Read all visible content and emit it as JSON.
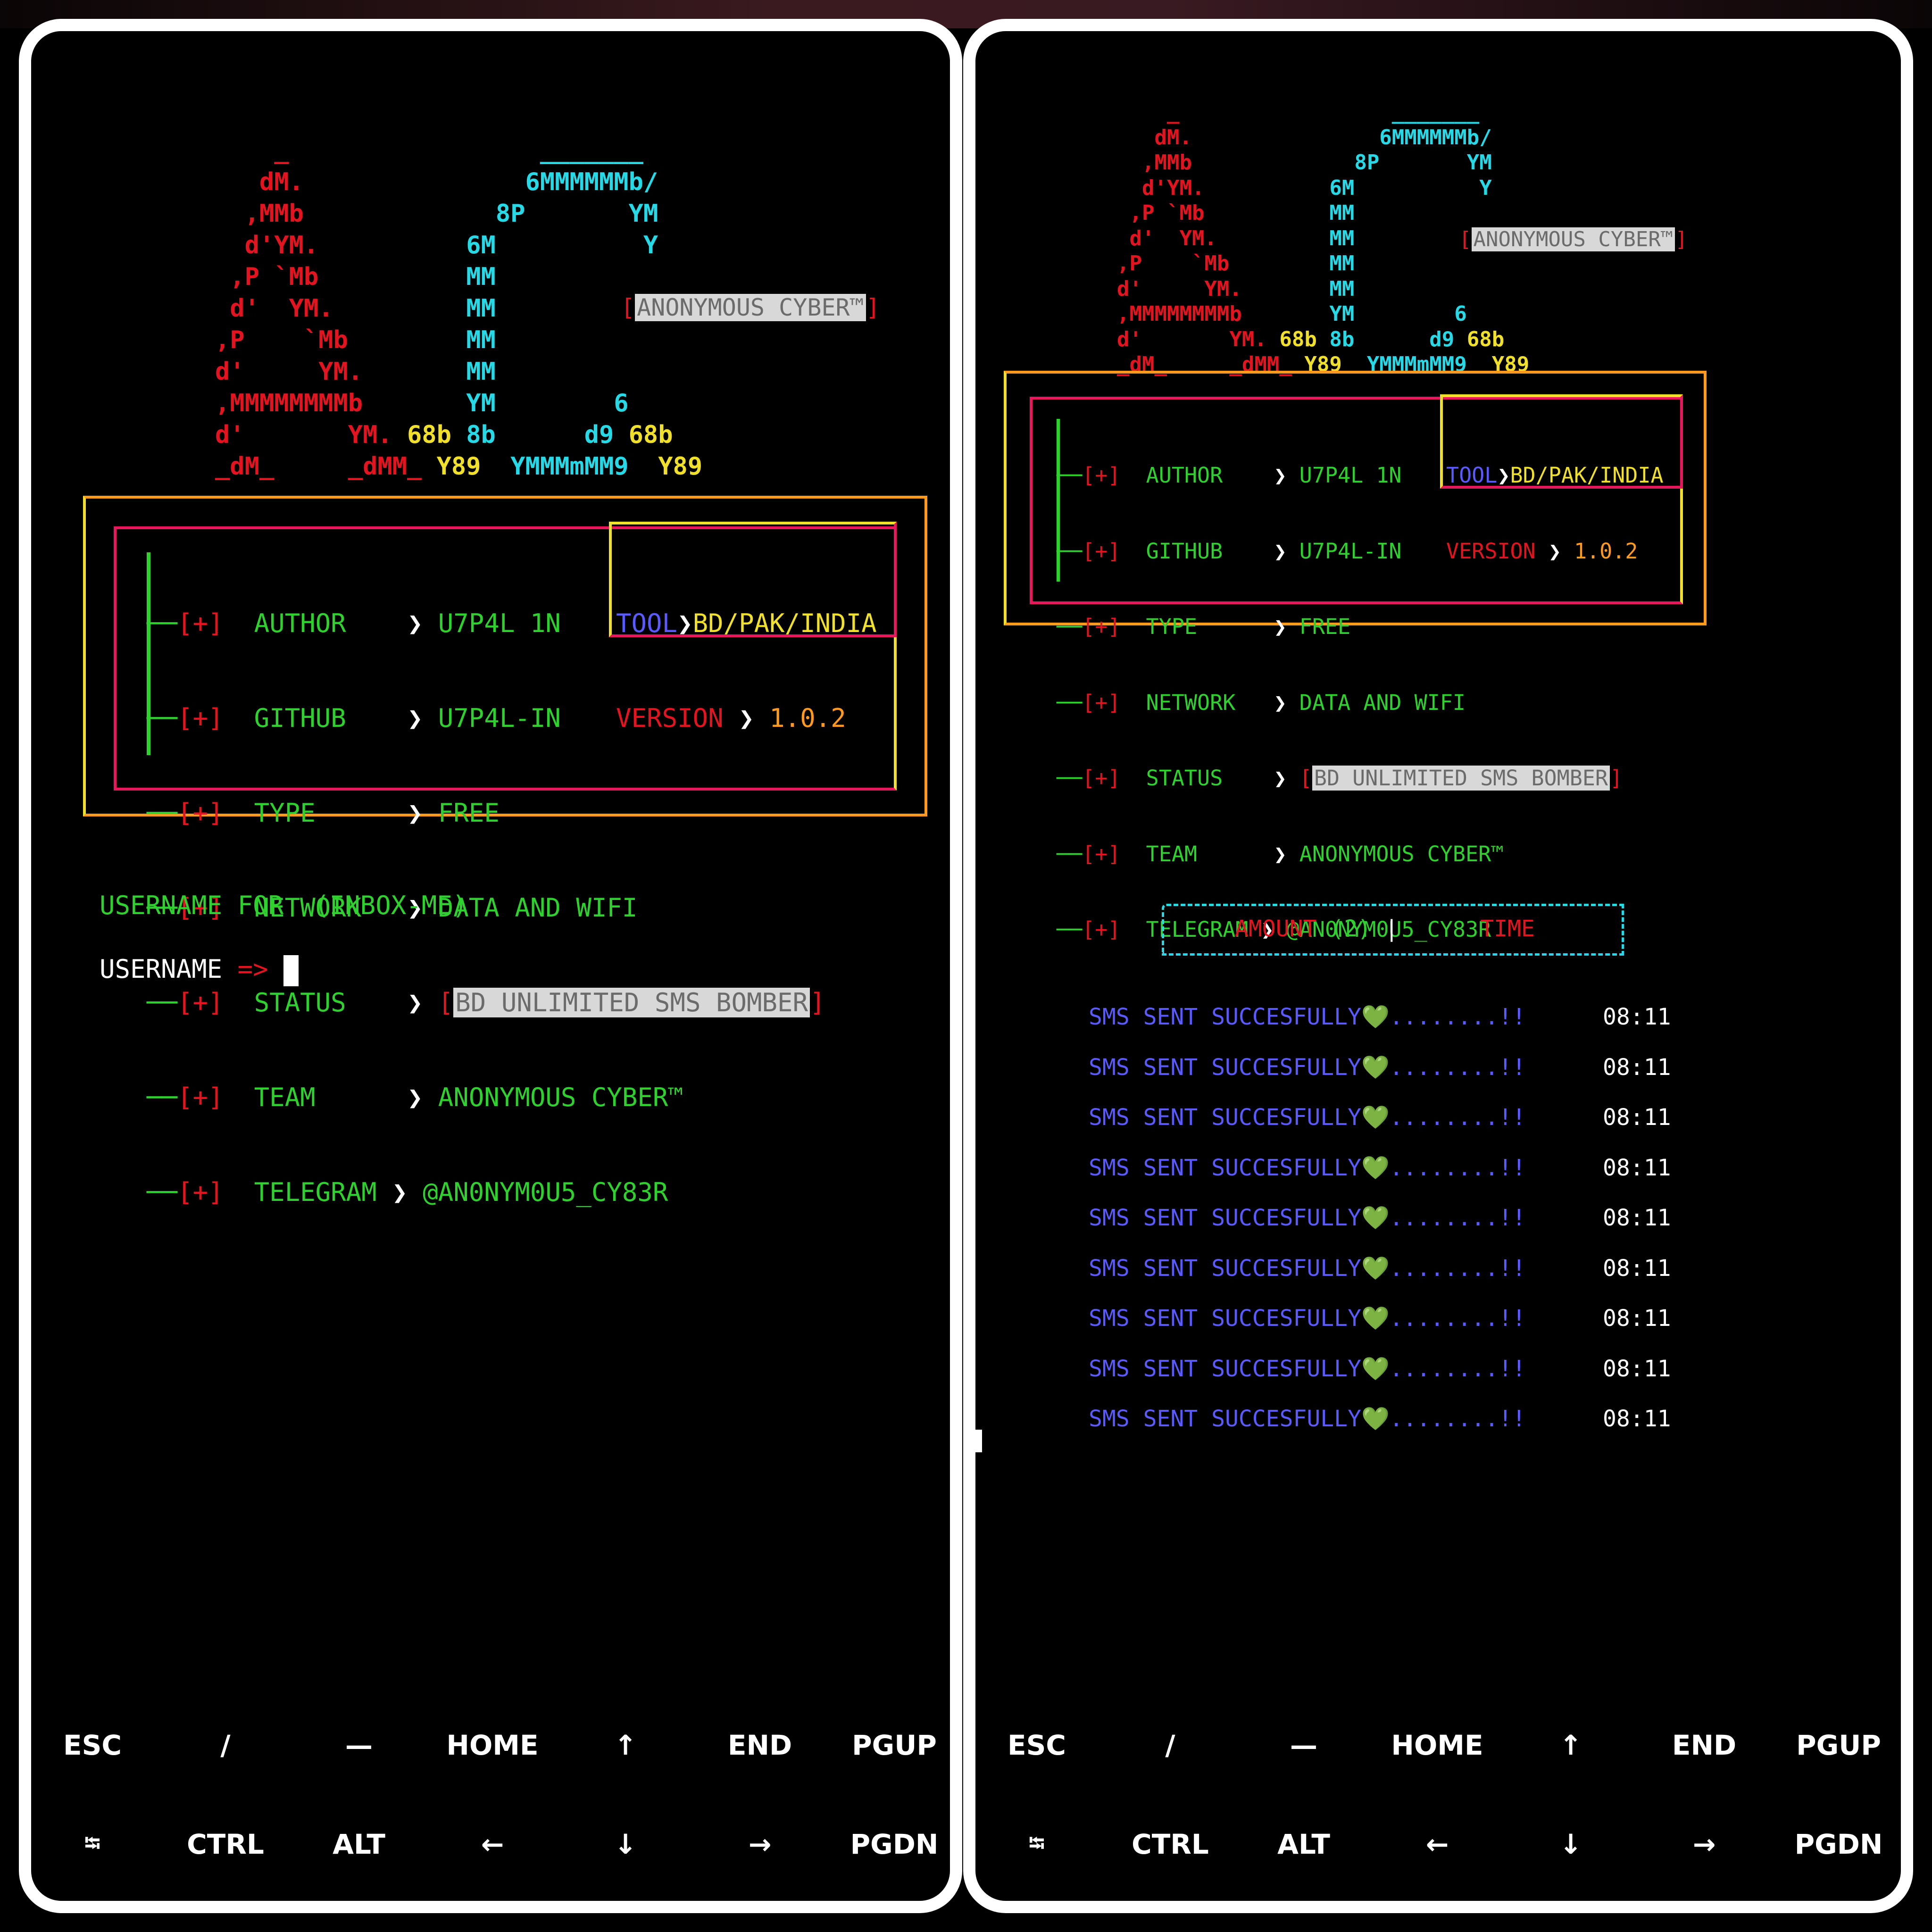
{
  "panels": {
    "left": {
      "id": "left"
    },
    "right": {
      "id": "right"
    }
  },
  "banner": {
    "badge": "ANONYMOUS CYBER™",
    "badge_bracket_open": "[",
    "badge_bracket_close": "]"
  },
  "info": {
    "bullet": "[+]",
    "rows": [
      {
        "key": "AUTHOR",
        "value": "U7P4L 1N"
      },
      {
        "key": "GITHUB",
        "value": "U7P4L-IN"
      },
      {
        "key": "TYPE",
        "value": "FREE"
      },
      {
        "key": "NETWORK",
        "value": "DATA AND WIFI"
      },
      {
        "key": "STATUS",
        "value": "BD UNLIMITED SMS BOMBER"
      },
      {
        "key": "TEAM",
        "value": "ANONYMOUS CYBER™"
      },
      {
        "key": "TELEGRAM",
        "value": "@AN0NYM0U5_CY83R"
      }
    ],
    "arrow": "❯",
    "tool_label": "TOOL",
    "tool_value": "BD/PAK/INDIA",
    "version_label": "VERSION",
    "version_value": "1.0.2"
  },
  "prompt": {
    "heading": "USERNAME FOR  (INBOX-ME)",
    "label": "USERNAME",
    "arrow": "=>"
  },
  "results": {
    "amount_label": "AMOUNT",
    "amount_value": "(2)",
    "time_label": "TIME",
    "message": "SMS SENT SUCCESFULLY",
    "heart": "💚",
    "dots": "........!!",
    "time_value": "08:11",
    "count": 9
  },
  "keyboard": {
    "row1": [
      "ESC",
      "/",
      "—",
      "HOME",
      "↑",
      "END",
      "PGUP"
    ],
    "row2": [
      "⭾",
      "CTRL",
      "ALT",
      "←",
      "↓",
      "→",
      "PGDN"
    ]
  },
  "colors": {
    "red": "#e3141f",
    "cyan": "#26d9e6",
    "yellow": "#f0e02a",
    "green": "#2fd12f",
    "orange": "#ff9a1f",
    "blue": "#5a5aff",
    "pink": "#e8175d"
  }
}
